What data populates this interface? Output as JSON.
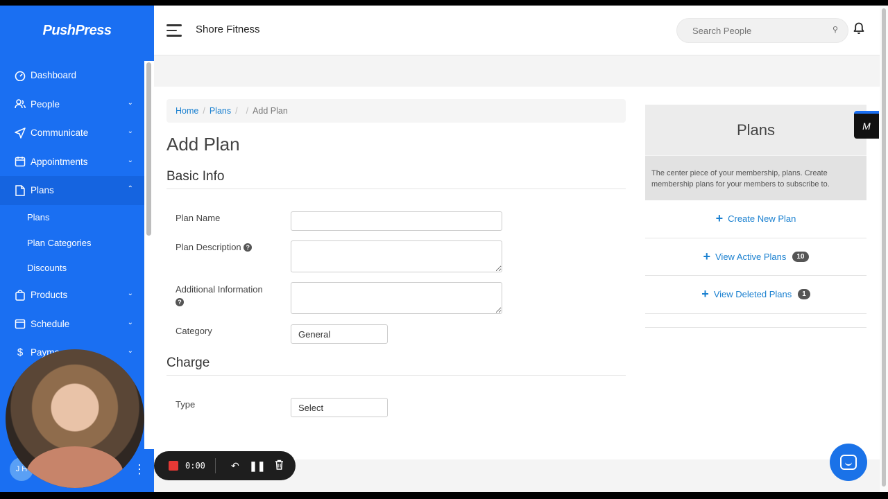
{
  "brand": {
    "logo_text": "PushPress"
  },
  "sidebar": {
    "items": [
      {
        "label": "Dashboard",
        "icon": "dashboard-icon",
        "has_chevron": false
      },
      {
        "label": "People",
        "icon": "people-icon",
        "has_chevron": true
      },
      {
        "label": "Communicate",
        "icon": "send-icon",
        "has_chevron": true
      },
      {
        "label": "Appointments",
        "icon": "calendar-icon",
        "has_chevron": true
      },
      {
        "label": "Plans",
        "icon": "plans-icon",
        "has_chevron": true,
        "expanded": true
      }
    ],
    "sub_items": [
      "Plans",
      "Plan Categories",
      "Discounts"
    ],
    "items_after": [
      {
        "label": "Products",
        "icon": "bag-icon"
      },
      {
        "label": "Schedule",
        "icon": "calendar-icon"
      },
      {
        "label": "Payme",
        "icon": "dollar-icon"
      }
    ],
    "user_initials": "J H"
  },
  "header": {
    "org_name": "Shore Fitness",
    "search_placeholder": "Search People"
  },
  "breadcrumb": {
    "home": "Home",
    "plans": "Plans",
    "sep": "/",
    "current": "Add Plan"
  },
  "page": {
    "title": "Add Plan",
    "basic_info_heading": "Basic Info",
    "charge_heading": "Charge"
  },
  "form": {
    "plan_name_label": "Plan Name",
    "plan_description_label": "Plan Description",
    "additional_info_label": "Additional Information",
    "category_label": "Category",
    "category_value": "General",
    "type_label": "Type",
    "type_value": "Select",
    "help_glyph": "?"
  },
  "panel": {
    "title": "Plans",
    "description": "The center piece of your membership, plans. Create membership plans for your members to subscribe to.",
    "links": [
      {
        "label": "Create New Plan",
        "badge": ""
      },
      {
        "label": "View Active Plans",
        "badge": "10"
      },
      {
        "label": "View Deleted Plans",
        "badge": "1"
      }
    ]
  },
  "recorder": {
    "time": "0:00"
  },
  "colors": {
    "sidebar": "#1a6ff2",
    "link": "#1a80d0",
    "record": "#e53935"
  }
}
